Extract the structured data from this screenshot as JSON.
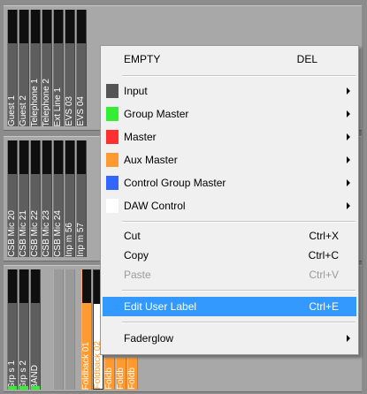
{
  "colors": {
    "green": "#33ee33",
    "orange": "#ff9a30",
    "red": "#ff3030",
    "blue": "#3366ff",
    "dark": "#555555",
    "highlight": "#3399ff"
  },
  "rows": {
    "row1": [
      "Guest 1",
      "Guest 2",
      "Telephone 1",
      "Telephone 2",
      "Ext Line 1",
      "EVS 03",
      "EVS 04"
    ],
    "row2": [
      "CSB Mic 20",
      "CSB Mic 21",
      "CSB Mic 22",
      "CSB Mic 23",
      "CSB Mic 24",
      "Inp m 56",
      "Inp m 57"
    ],
    "row3": [
      "Grp s 1",
      "Grp s 2",
      "BAND",
      "",
      "",
      "Foldback 01",
      "Foldback 02",
      "Foldb",
      "Foldb",
      "Foldb"
    ]
  },
  "menu": {
    "empty_label": "EMPTY",
    "empty_shortcut": "DEL",
    "input": "Input",
    "group_master": "Group Master",
    "master": "Master",
    "aux_master": "Aux Master",
    "control_group_master": "Control Group Master",
    "daw_control": "DAW Control",
    "cut": "Cut",
    "cut_shortcut": "Ctrl+X",
    "copy": "Copy",
    "copy_shortcut": "Ctrl+C",
    "paste": "Paste",
    "paste_shortcut": "Ctrl+V",
    "edit_user_label": "Edit User Label",
    "edit_user_label_shortcut": "Ctrl+E",
    "faderglow": "Faderglow"
  }
}
